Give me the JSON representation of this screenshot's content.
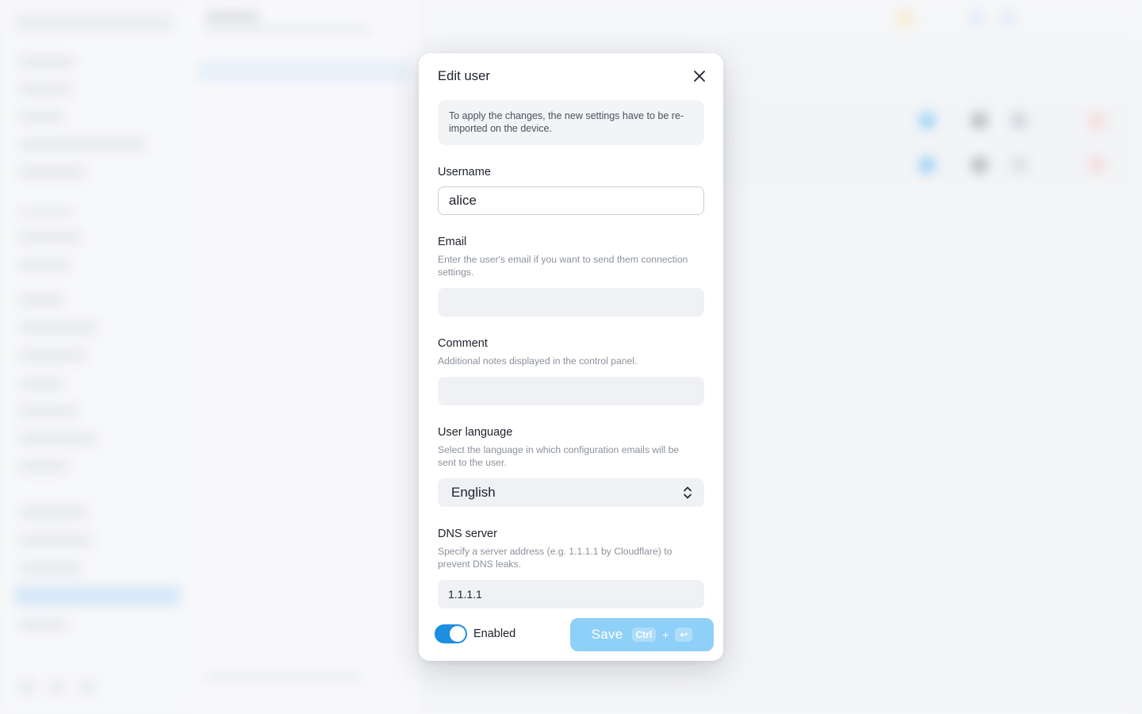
{
  "modal": {
    "title": "Edit user",
    "notice": "To apply the changes, the new settings have to be re-imported on the device.",
    "fields": {
      "username": {
        "label": "Username",
        "value": "alice"
      },
      "email": {
        "label": "Email",
        "description": "Enter the user's email if you want to send them connection settings.",
        "value": ""
      },
      "comment": {
        "label": "Comment",
        "description": "Additional notes displayed in the control panel.",
        "value": ""
      },
      "language": {
        "label": "User language",
        "description": "Select the language in which configuration emails will be sent to the user.",
        "value": "English"
      },
      "dns": {
        "label": "DNS server",
        "description": "Specify a server address (e.g. 1.1.1.1 by Cloudflare) to prevent DNS leaks.",
        "value": "1.1.1.1"
      }
    },
    "footer": {
      "enabled_label": "Enabled",
      "enabled": true,
      "save_label": "Save",
      "shortcut_ctrl": "Ctrl",
      "shortcut_plus": "+",
      "shortcut_enter": "↩"
    }
  },
  "colors": {
    "accent": "#1d8ee0",
    "save_button": "#8fd0f8",
    "input_bg": "#f0f1f4",
    "notice_bg": "#f3f4f6"
  },
  "icons": {
    "close": "close-icon",
    "select_chevrons": "chevron-up-down-icon"
  }
}
